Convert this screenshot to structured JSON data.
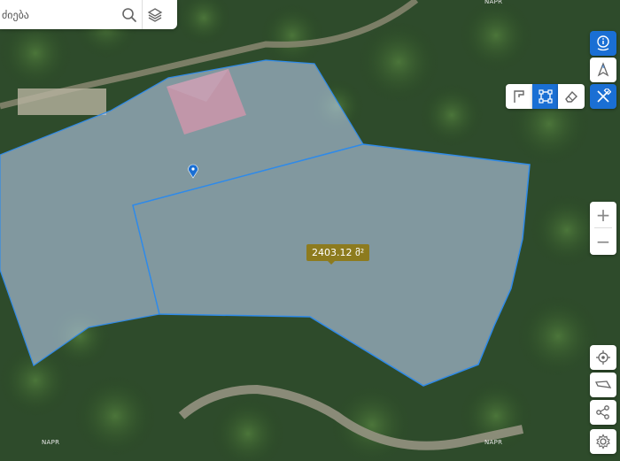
{
  "search": {
    "value": "ძიება"
  },
  "measurement": {
    "area_label": "2403.12 მ²"
  },
  "attribution": {
    "text": "NAPR"
  },
  "controls": {
    "zoom_in": "+",
    "zoom_out": "−"
  },
  "colors": {
    "accent": "#1a6fd4",
    "parcel_fill": "#b4c8e6",
    "parcel_stroke": "#2f8ae8",
    "label_bg": "#8d7b1e"
  },
  "icons": [
    "search-icon",
    "layers-icon",
    "info-icon",
    "compass-icon",
    "tools-icon",
    "polyline-icon",
    "polygon-icon",
    "eraser-icon",
    "zoom-in-icon",
    "zoom-out-icon",
    "locate-icon",
    "track-icon",
    "share-icon",
    "settings-icon",
    "map-pin-icon"
  ]
}
